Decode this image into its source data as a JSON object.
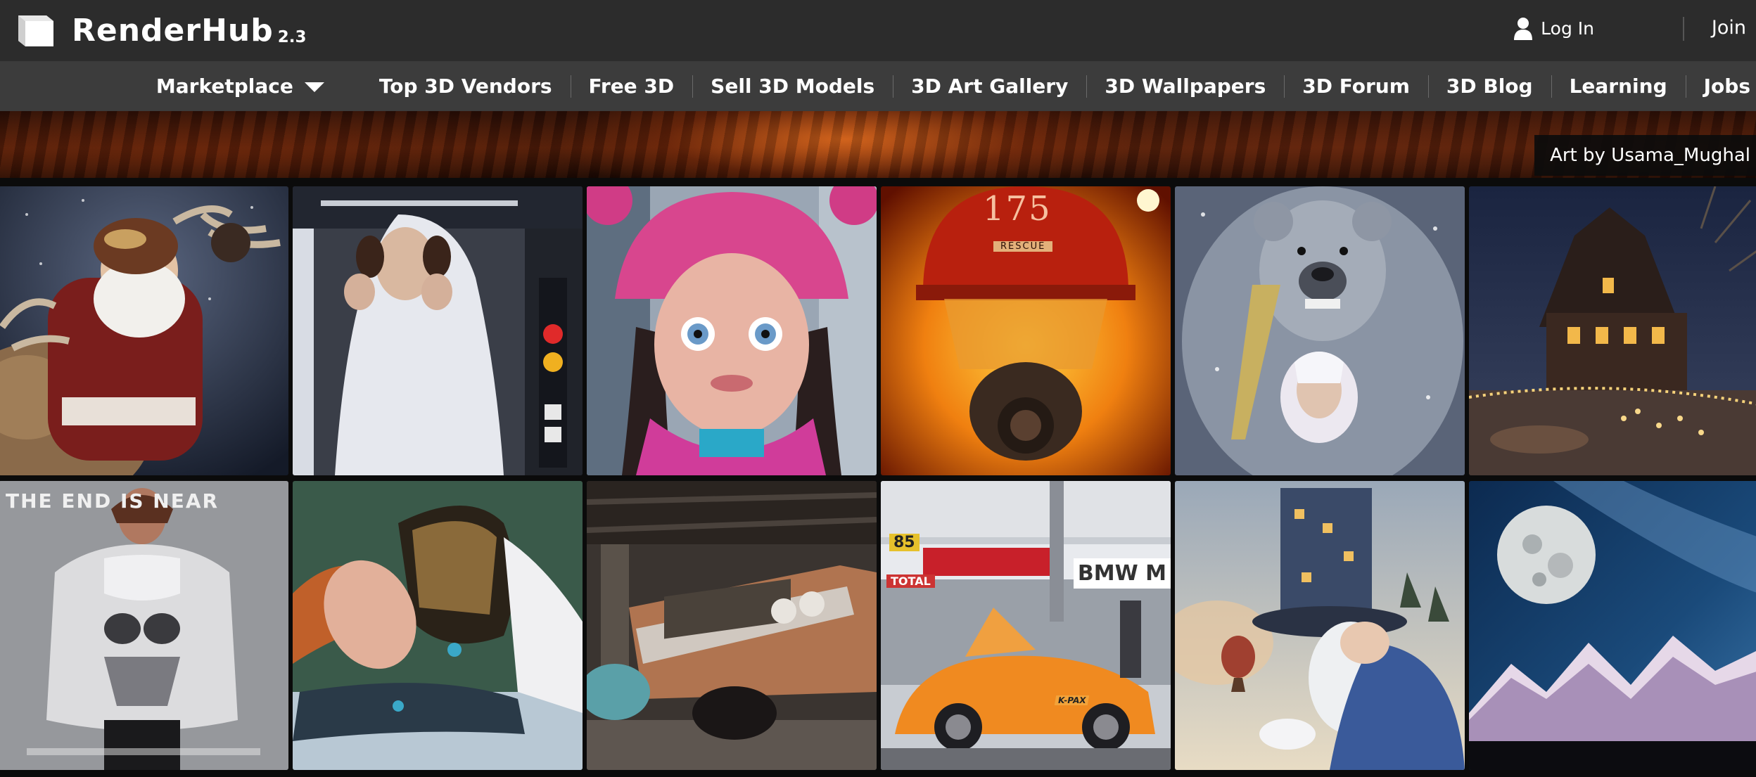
{
  "header": {
    "brand": "RenderHub",
    "version": "2.3",
    "login_label": "Log In",
    "join_label": "Join",
    "icons": {
      "logo": "cube-icon",
      "user": "user-icon"
    }
  },
  "nav": {
    "items": [
      {
        "label": "Marketplace",
        "has_dropdown": true
      },
      {
        "label": "Top 3D Vendors"
      },
      {
        "label": "Free 3D"
      },
      {
        "label": "Sell 3D Models"
      },
      {
        "label": "3D Art Gallery"
      },
      {
        "label": "3D Wallpapers"
      },
      {
        "label": "3D Forum"
      },
      {
        "label": "3D Blog"
      },
      {
        "label": "Learning"
      },
      {
        "label": "Jobs"
      }
    ],
    "icons": {
      "dropdown": "caret-down-icon"
    }
  },
  "banner": {
    "credit": "Art by Usama_Mughal"
  },
  "gallery": {
    "tiles": [
      {
        "subject": "santa-reindeer"
      },
      {
        "subject": "princess-leia"
      },
      {
        "subject": "girl-pink-hat"
      },
      {
        "subject": "firefighter",
        "helmet_number": "175",
        "helmet_text": "RESCUE"
      },
      {
        "subject": "bear-elf-warrior"
      },
      {
        "subject": "winter-mansion"
      },
      {
        "subject": "puffer-jacket",
        "headline": "THE END IS NEAR"
      },
      {
        "subject": "woman-lying-snow"
      },
      {
        "subject": "classic-car-garage"
      },
      {
        "subject": "race-car-pit",
        "sign": "BMW M",
        "pit_number": "85",
        "sponsor": "TOTAL",
        "car_text": "K-PAX"
      },
      {
        "subject": "wizard-top-hat"
      },
      {
        "subject": "moon-mountains"
      }
    ]
  },
  "colors": {
    "topbar": "#2c2c2c",
    "navbar": "#3c3c3c",
    "page": "#0b0b0b",
    "text": "#ffffff"
  }
}
